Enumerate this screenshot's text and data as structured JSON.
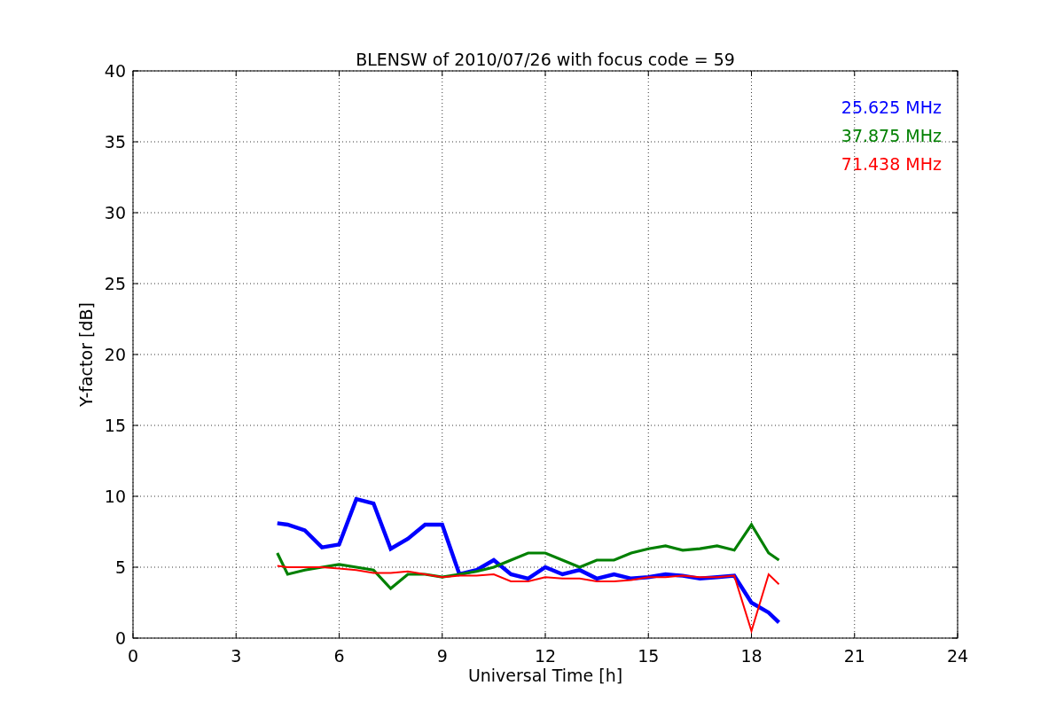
{
  "figure": {
    "chart_data": {
      "type": "line",
      "title": "BLENSW of 2010/07/26 with focus code = 59",
      "xlabel": "Universal Time [h]",
      "ylabel": "Y-factor [dB]",
      "x": [
        4.2,
        4.5,
        5,
        5.5,
        6,
        6.5,
        7,
        7.5,
        8,
        8.5,
        9,
        9.5,
        10,
        10.5,
        11,
        11.5,
        12,
        12.5,
        13,
        13.5,
        14,
        14.5,
        15,
        15.5,
        16,
        16.5,
        17,
        17.5,
        18,
        18.5,
        18.8
      ],
      "series": [
        {
          "name": "25.625 MHz",
          "color": "#0000ff",
          "values": [
            8.1,
            8.0,
            7.6,
            6.4,
            6.6,
            9.8,
            9.5,
            6.3,
            7.0,
            8.0,
            8.0,
            4.5,
            4.8,
            5.5,
            4.5,
            4.2,
            5.0,
            4.5,
            4.8,
            4.2,
            4.5,
            4.2,
            4.3,
            4.5,
            4.4,
            4.2,
            4.3,
            4.4,
            2.5,
            1.8,
            1.1
          ]
        },
        {
          "name": "37.875 MHz",
          "color": "#008000",
          "values": [
            6.0,
            4.5,
            4.8,
            5.0,
            5.2,
            5.0,
            4.8,
            3.5,
            4.5,
            4.5,
            4.3,
            4.5,
            4.7,
            5.0,
            5.5,
            6.0,
            6.0,
            5.5,
            5.0,
            5.5,
            5.5,
            6.0,
            6.3,
            6.5,
            6.2,
            6.3,
            6.5,
            6.2,
            8.0,
            6.0,
            5.5
          ]
        },
        {
          "name": "71.438 MHz",
          "color": "#ff0000",
          "values": [
            5.1,
            5.0,
            5.0,
            5.0,
            4.9,
            4.8,
            4.6,
            4.6,
            4.7,
            4.5,
            4.3,
            4.4,
            4.4,
            4.5,
            4.0,
            4.0,
            4.3,
            4.2,
            4.2,
            4.0,
            4.0,
            4.1,
            4.3,
            4.3,
            4.4,
            4.3,
            4.3,
            4.4,
            0.5,
            4.5,
            3.8
          ]
        }
      ],
      "grid": true,
      "xlim": [
        0,
        24
      ],
      "ylim": [
        0,
        40
      ],
      "xticks": [
        0,
        3,
        6,
        9,
        12,
        15,
        18,
        21,
        24
      ],
      "yticks": [
        0,
        5,
        10,
        15,
        20,
        25,
        30,
        35,
        40
      ]
    }
  }
}
